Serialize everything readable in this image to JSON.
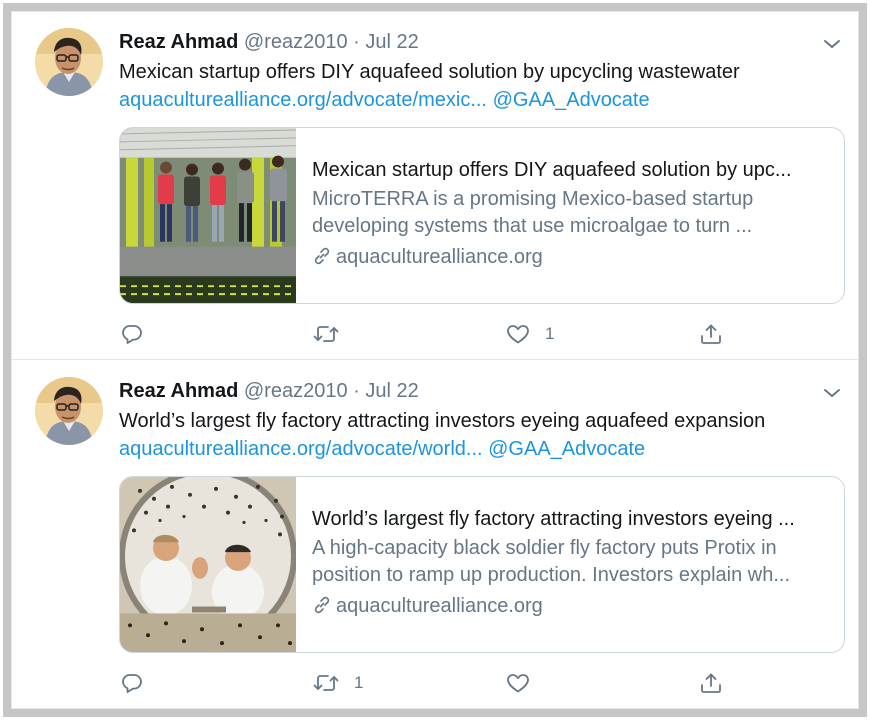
{
  "tweets": [
    {
      "name": "Reaz Ahmad",
      "handle": "@reaz2010",
      "sep": " · ",
      "date": "Jul 22",
      "text": "Mexican startup offers DIY aquafeed solution by upcycling wastewater",
      "link_url": "aquaculturealliance.org/advocate/mexic...",
      "link_mention": "@GAA_Advocate",
      "card": {
        "title": "Mexican startup offers DIY aquafeed solution by upc...",
        "desc_line1": "MicroTERRA is a promising Mexico-based startup",
        "desc_line2": "developing systems that use microalgae to turn ...",
        "domain": "aquaculturealliance.org"
      },
      "reply_count": "",
      "retweet_count": "",
      "like_count": "1"
    },
    {
      "name": "Reaz Ahmad",
      "handle": "@reaz2010",
      "sep": " · ",
      "date": "Jul 22",
      "text": "World’s largest fly factory attracting investors eyeing aquafeed expansion",
      "link_url": "aquaculturealliance.org/advocate/world...",
      "link_mention": "@GAA_Advocate",
      "card": {
        "title": "World’s largest fly factory attracting investors eyeing ...",
        "desc_line1": "A high-capacity black soldier fly factory puts Protix in",
        "desc_line2": "position to ramp up production. Investors explain wh...",
        "domain": "aquaculturealliance.org"
      },
      "reply_count": "",
      "retweet_count": "1",
      "like_count": ""
    }
  ],
  "icons": {
    "caret": "chevron-down-icon",
    "link": "link-icon",
    "reply": "reply-icon",
    "retweet": "retweet-icon",
    "like": "heart-icon",
    "share": "share-icon"
  },
  "colors": {
    "link": "#1b95e0",
    "secondary": "#657786",
    "border": "#ccd6dd",
    "icon": "#657786"
  }
}
